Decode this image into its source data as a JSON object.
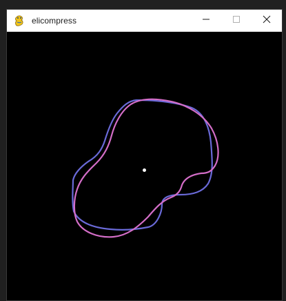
{
  "window": {
    "title": "elicompress",
    "icon": "pygame-snake-icon"
  },
  "controls": {
    "minimize_icon": "minimize-icon",
    "maximize_icon": "maximize-icon",
    "close_icon": "close-icon"
  },
  "canvas": {
    "background": "#000000",
    "center_dot_color": "#ffffff",
    "curves": [
      {
        "color": "#6a6ad8",
        "icon": "blue-closed-curve"
      },
      {
        "color": "#d46ec8",
        "icon": "pink-closed-curve"
      }
    ]
  }
}
